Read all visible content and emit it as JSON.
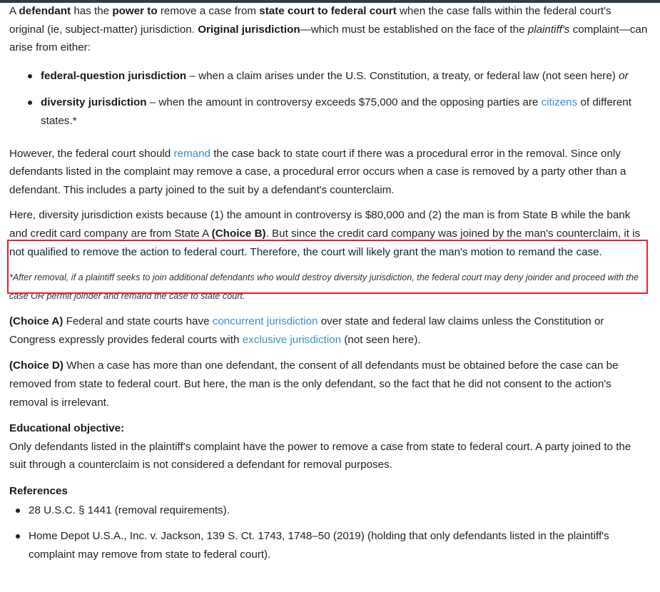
{
  "intro": {
    "t1": "A ",
    "b1": "defendant",
    "t2": " has the ",
    "b2": "power to",
    "t3": " remove a case from ",
    "b3": "state court to federal court",
    "t4": " when the case falls within the federal court's original (ie, subject-matter) jurisdiction.  ",
    "b4": "Original jurisdiction",
    "t5": "—which must be established on the face of the ",
    "i1": "plaintiff's",
    "t6": " complaint—can arise from either:"
  },
  "bullets": [
    {
      "bold": "federal-question jurisdiction",
      "text": " – when a claim arises under the U.S. Constitution, a treaty, or federal law (not seen here) ",
      "italic": "or"
    },
    {
      "bold": "diversity jurisdiction",
      "text": " – when the amount in controversy exceeds $75,000 and the opposing parties are ",
      "link": "citizens",
      "tail": " of different states.*"
    }
  ],
  "para_remand": {
    "t1": "However, the federal court should ",
    "link": "remand",
    "t2": " the case back to state court if there was a procedural error in the removal.  Since only defendants listed in the complaint may remove a case, a procedural error occurs when a case is removed by a party other than a defendant.  This includes a party joined to the suit by a defendant's counterclaim."
  },
  "para_here": {
    "t1": "Here, diversity jurisdiction exists because (1) the amount in controversy is $80,000 and (2) the man is from State B while the bank and credit card company are from State A ",
    "b1": "(Choice B)",
    "t2": ".  But since the credit card company was joined by the man's counterclaim, it is not qualified to remove the action to federal court.  Therefore, the court will likely grant the man's motion to remand the case."
  },
  "footnote": "*After removal, if a plaintiff seeks to join additional defendants who would destroy diversity jurisdiction, the federal court may deny joinder and proceed with the case OR permit joinder and remand the case to state court.",
  "choice_a": {
    "label": "(Choice A)",
    "t1": "  Federal and state courts have ",
    "link1": "concurrent jurisdiction",
    "t2": " over state and federal law claims unless the Constitution or Congress expressly provides federal courts with ",
    "link2": "exclusive jurisdiction",
    "t3": " (not seen here)."
  },
  "choice_d": {
    "label": "(Choice D)",
    "t1": "  When a case has more than one defendant, the consent of all defendants must be obtained before the case can be removed from state to federal court.  But here, the man is the only defendant, so the fact that he did not consent to the action's removal is irrelevant."
  },
  "objective": {
    "heading": "Educational objective:",
    "text": "Only defendants listed in the plaintiff's complaint have the power to remove a case from state to federal court.  A party joined to the suit through a counterclaim is not considered a defendant for removal purposes."
  },
  "references": {
    "heading": "References",
    "items": [
      "28 U.S.C. § 1441 (removal requirements).",
      "Home Depot U.S.A., Inc. v. Jackson, 139 S. Ct. 1743, 1748–50 (2019) (holding that only defendants listed in the plaintiff's complaint may remove from state to federal court)."
    ]
  }
}
